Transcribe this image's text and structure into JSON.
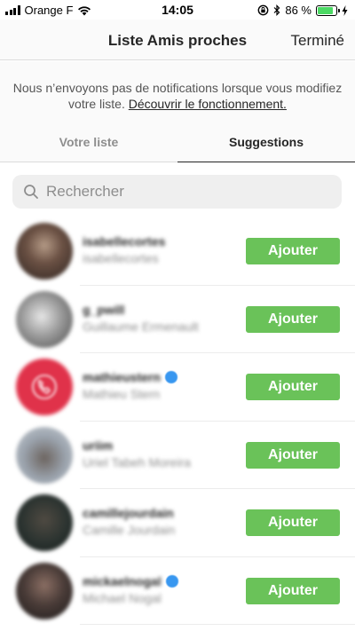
{
  "status_bar": {
    "carrier": "Orange F",
    "time": "14:05",
    "battery": "86 %",
    "battery_level": 0.86
  },
  "nav": {
    "title": "Liste Amis proches",
    "done": "Terminé"
  },
  "info": {
    "text": "Nous n’envoyons pas de notifications lorsque vous modifiez votre liste.",
    "link": "Découvrir le fonctionnement."
  },
  "tabs": {
    "your_list": "Votre liste",
    "suggestions": "Suggestions"
  },
  "search": {
    "placeholder": "Rechercher"
  },
  "suggestions": [
    {
      "username": "isabellecortes",
      "fullname": "isabellecortes",
      "verified": false,
      "button": "Ajouter"
    },
    {
      "username": "g_pwill",
      "fullname": "Guillaume Ermenault",
      "verified": false,
      "button": "Ajouter"
    },
    {
      "username": "mathieustern",
      "fullname": "Mathieu Stern",
      "verified": true,
      "button": "Ajouter"
    },
    {
      "username": "uriim",
      "fullname": "Uriel Tabeh Moreira",
      "verified": false,
      "button": "Ajouter"
    },
    {
      "username": "camillejourdain",
      "fullname": "Camille Jourdain",
      "verified": false,
      "button": "Ajouter"
    },
    {
      "username": "mickaelnogal",
      "fullname": "Michael Nogal",
      "verified": true,
      "button": "Ajouter"
    }
  ],
  "colors": {
    "add_button": "#6ac259",
    "verified_badge": "#3897f0",
    "battery": "#4cd964"
  }
}
